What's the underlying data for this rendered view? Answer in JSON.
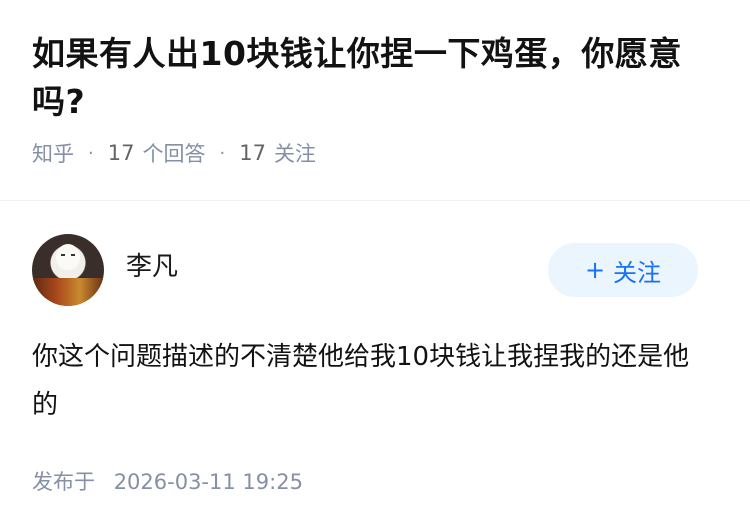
{
  "question": {
    "title": "如果有人出10块钱让你捏一下鸡蛋，你愿意吗?",
    "source": "知乎",
    "answers_count": "17",
    "answers_label": "个回答",
    "followers_count": "17",
    "followers_label": "关注"
  },
  "author": {
    "name": "李凡",
    "avatar_icon": "avatar-image",
    "follow_plus": "+",
    "follow_label": "关注",
    "follow_color": "#1772f6"
  },
  "answer": {
    "text": "你这个问题描述的不清楚他给我10块钱让我捏我的还是他的",
    "published_label": "发布于",
    "published_date": "2026-03-11 19:25"
  }
}
